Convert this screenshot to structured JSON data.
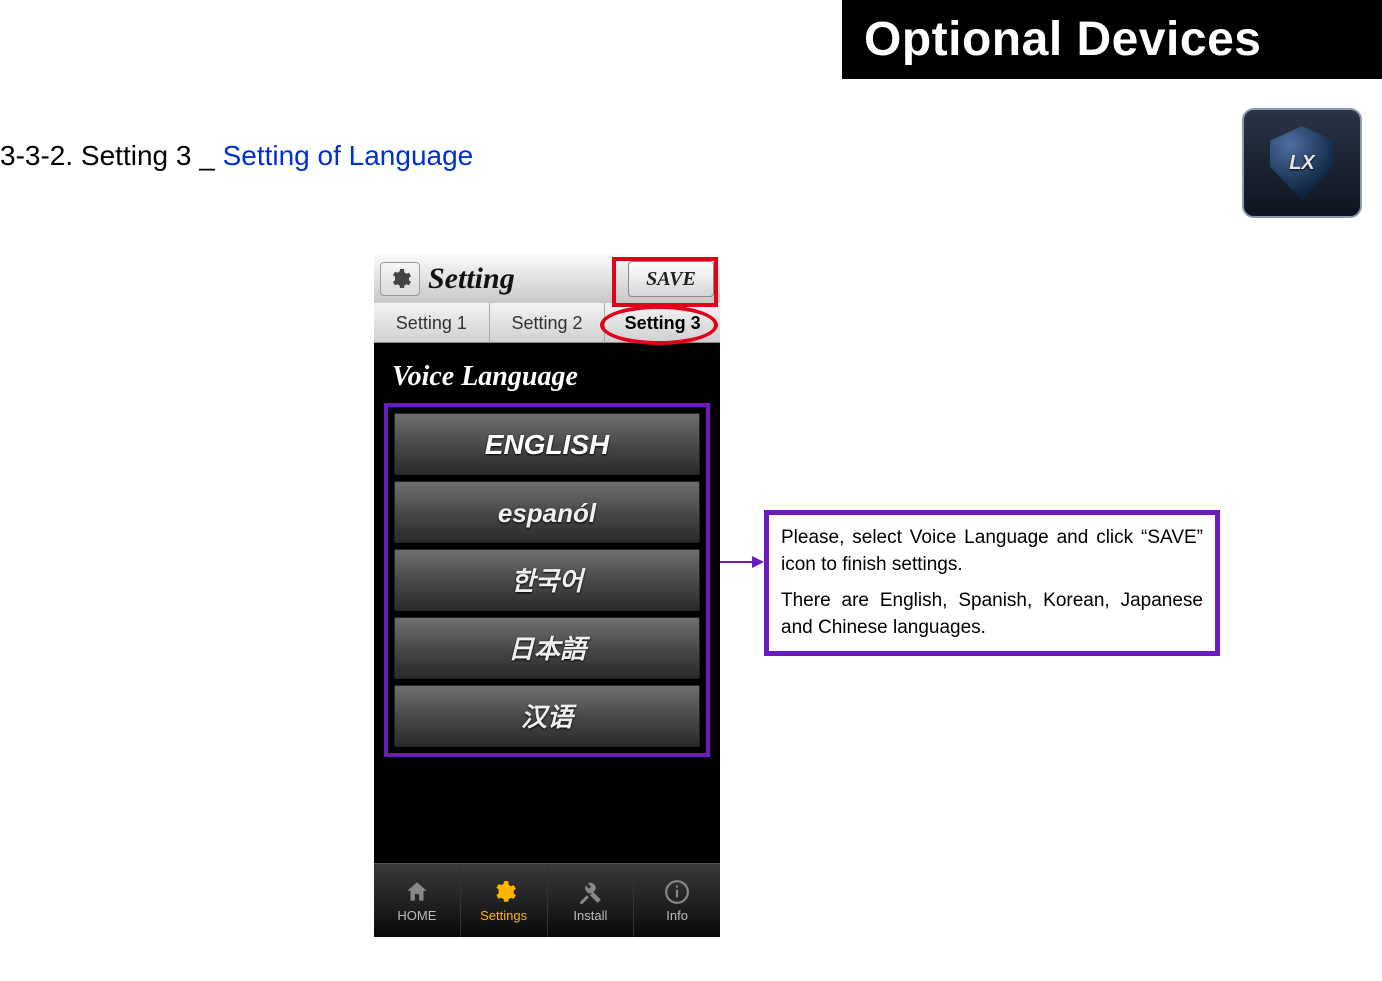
{
  "banner": {
    "title": "Optional Devices"
  },
  "logo": {
    "text": "LX"
  },
  "section": {
    "prefix": "3-3-2. Setting 3 _ ",
    "title": "Setting of Language"
  },
  "phone": {
    "header_title": "Setting",
    "save_label": "SAVE",
    "tabs": [
      "Setting 1",
      "Setting 2",
      "Setting 3"
    ],
    "voice_title": "Voice Language",
    "languages": [
      "ENGLISH",
      "espanól",
      "한국어",
      "日本語",
      "汉语"
    ],
    "nav": [
      {
        "label": "HOME",
        "icon": "home-icon"
      },
      {
        "label": "Settings",
        "icon": "gear-icon"
      },
      {
        "label": "Install",
        "icon": "tools-icon"
      },
      {
        "label": "Info",
        "icon": "info-icon"
      }
    ]
  },
  "callout": {
    "line1": "Please, select Voice Language and click “SAVE” icon to finish settings.",
    "line2": "There are English, Spanish, Korean, Japanese and Chinese languages."
  }
}
